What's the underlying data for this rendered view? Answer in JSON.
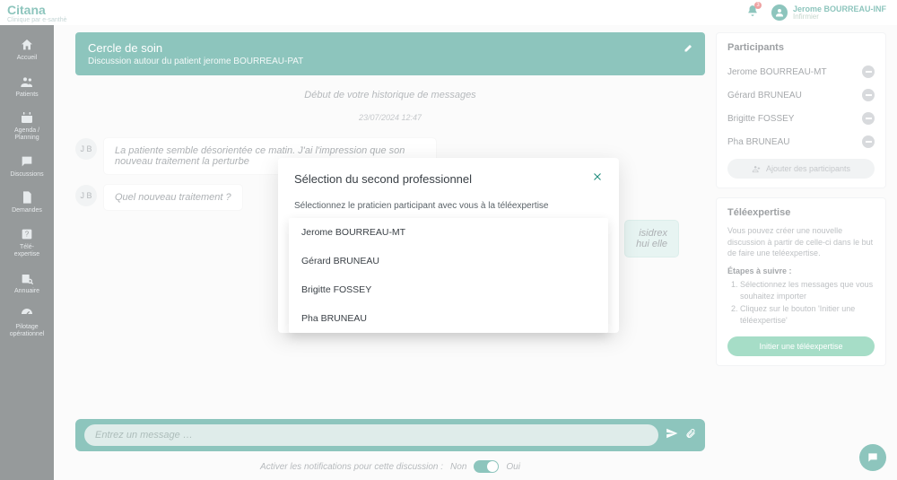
{
  "brand": {
    "name": "Citana",
    "tagline": "Clinique par e-santhè"
  },
  "user": {
    "name": "Jerome BOURREAU-INF",
    "role": "Infirmier"
  },
  "notifications": {
    "count": "3"
  },
  "sidebar": {
    "items": [
      {
        "label": "Accueil"
      },
      {
        "label": "Patients"
      },
      {
        "label": "Agenda /\nPlanning"
      },
      {
        "label": "Discussions"
      },
      {
        "label": "Demandes"
      },
      {
        "label": "Télé-\nexpertise"
      },
      {
        "label": "Annuaire"
      },
      {
        "label": "Pilotage\nopérationnel"
      }
    ]
  },
  "chat": {
    "title": "Cercle de soin",
    "subtitle": "Discussion autour du patient jerome BOURREAU-PAT",
    "history_start": "Début de votre historique de messages",
    "timestamp": "23/07/2024 12:47",
    "messages": [
      {
        "initials": "J B",
        "text": "La patiente semble désorientée ce matin. J'ai l'impression que son nouveau traitement la perturbe"
      },
      {
        "initials": "J B",
        "text": "Quel nouveau traitement ?"
      }
    ],
    "reply_snippet": "isidrex\nhui elle",
    "input_placeholder": "Entrez un message …",
    "notif_label": "Activer les notifications pour cette discussion :",
    "notif_off": "Non",
    "notif_on": "Oui"
  },
  "participants": {
    "title": "Participants",
    "list": [
      {
        "name": "Jerome BOURREAU-MT"
      },
      {
        "name": "Gérard BRUNEAU"
      },
      {
        "name": "Brigitte FOSSEY"
      },
      {
        "name": "Pha BRUNEAU"
      }
    ],
    "add_label": "Ajouter des participants"
  },
  "teleexpertise": {
    "title": "Téléexpertise",
    "desc": "Vous pouvez créer une nouvelle discussion à partir de celle-ci dans le but de faire une teléexpertise.",
    "steps_title": "Étapes à suivre :",
    "steps": [
      "Sélectionnez les messages que vous souhaitez importer",
      "Cliquez sur le bouton 'Initier une téléexpertise'"
    ],
    "button": "Initier une téléexpertise"
  },
  "modal": {
    "title": "Sélection du second professionnel",
    "desc": "Sélectionnez le praticien participant avec vous à la téléexpertise",
    "options": [
      "Jerome BOURREAU-MT",
      "Gérard BRUNEAU",
      "Brigitte FOSSEY",
      "Pha BRUNEAU"
    ]
  }
}
